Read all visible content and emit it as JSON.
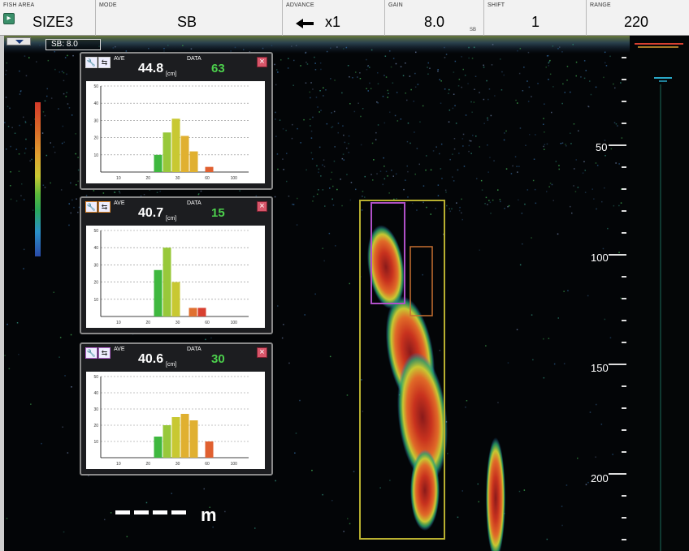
{
  "topbar": {
    "fish_area": {
      "label": "FISH AREA",
      "value": "SIZE3"
    },
    "mode": {
      "label": "MODE",
      "value": "SB"
    },
    "advance": {
      "label": "ADVANCE",
      "value": "x1"
    },
    "gain": {
      "label": "GAIN",
      "value": "8.0",
      "sub": "SB"
    },
    "shift": {
      "label": "SHIFT",
      "value": "1"
    },
    "range": {
      "label": "RANGE",
      "value": "220"
    }
  },
  "echogram": {
    "sb_tag": "SB: 8.0",
    "depth_labels": [
      "50",
      "100",
      "150",
      "200"
    ],
    "scale_unit": "m"
  },
  "panels": [
    {
      "ave_label": "AVE",
      "ave_value": "44.8",
      "unit": "[cm]",
      "data_label": "DATA",
      "data_value": "63",
      "icon_frame": "#d0d0d0",
      "chart_data": {
        "type": "bar",
        "y_ticks": [
          10,
          20,
          30,
          40,
          50
        ],
        "x_ticks": [
          "10",
          "20",
          "30",
          "60",
          "100"
        ],
        "ylim": [
          0,
          50
        ],
        "values": [
          10,
          23,
          31,
          21,
          12,
          3
        ],
        "bar_colors": [
          "#3fb83f",
          "#98c83a",
          "#c8c832",
          "#e0b030",
          "#e0b030",
          "#e06030"
        ]
      }
    },
    {
      "ave_label": "AVE",
      "ave_value": "40.7",
      "unit": "[cm]",
      "data_label": "DATA",
      "data_value": "15",
      "icon_frame": "#e08a30",
      "chart_data": {
        "type": "bar",
        "y_ticks": [
          10,
          20,
          30,
          40,
          50
        ],
        "x_ticks": [
          "10",
          "20",
          "30",
          "60",
          "100"
        ],
        "ylim": [
          0,
          50
        ],
        "values": [
          27,
          40,
          20,
          5,
          5
        ],
        "bar_colors": [
          "#3fb83f",
          "#98c83a",
          "#c8c832",
          "#e07030",
          "#d84030"
        ]
      }
    },
    {
      "ave_label": "AVE",
      "ave_value": "40.6",
      "unit": "[cm]",
      "data_label": "DATA",
      "data_value": "30",
      "icon_frame": "#b060c8",
      "chart_data": {
        "type": "bar",
        "y_ticks": [
          10,
          20,
          30,
          40,
          50
        ],
        "x_ticks": [
          "10",
          "20",
          "30",
          "60",
          "100"
        ],
        "ylim": [
          0,
          50
        ],
        "values": [
          13,
          20,
          25,
          27,
          23,
          10
        ],
        "bar_colors": [
          "#3fb83f",
          "#98c83a",
          "#c8c832",
          "#e0b030",
          "#e0b030",
          "#e06030"
        ]
      }
    }
  ]
}
